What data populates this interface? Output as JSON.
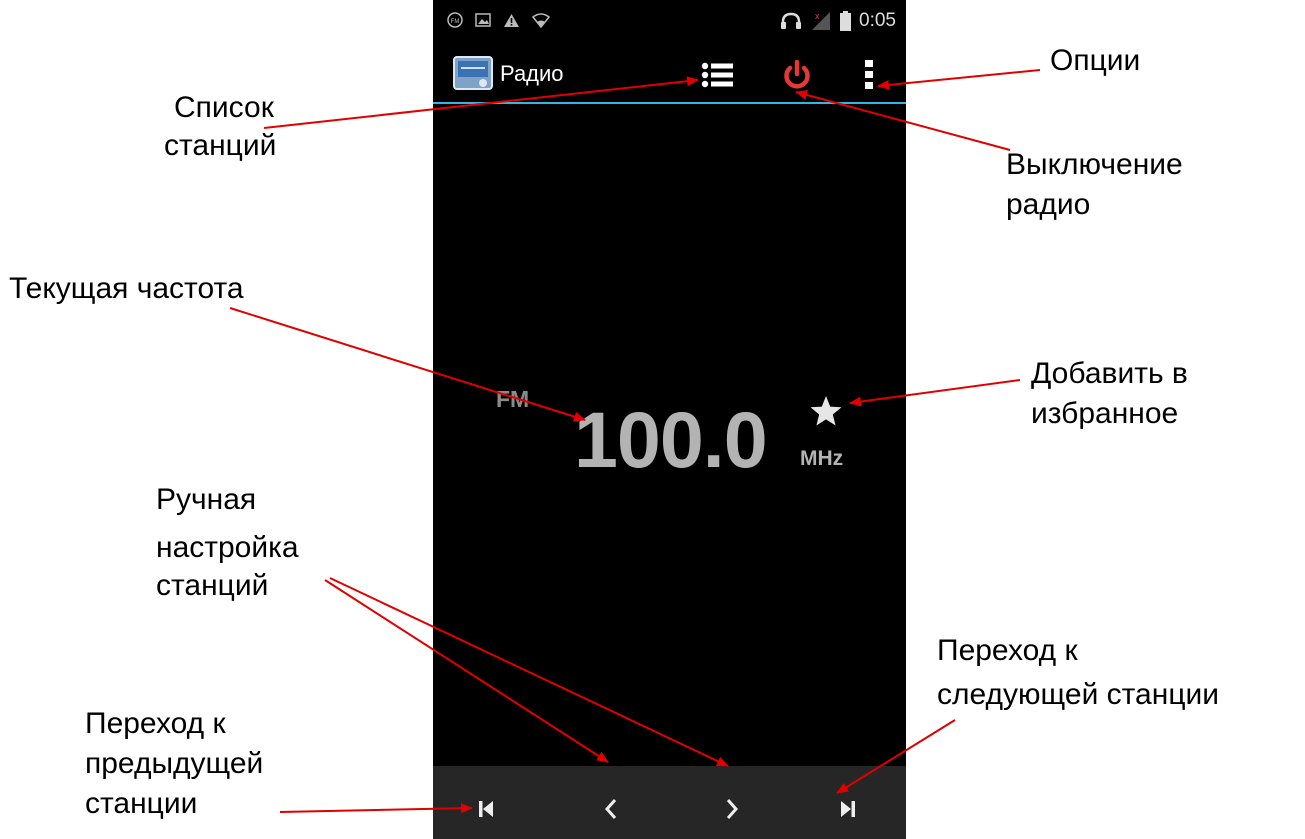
{
  "status_bar": {
    "time": "0:05",
    "left_icons": [
      "fm-notification-icon",
      "gallery-icon",
      "warning-icon",
      "wifi-icon"
    ],
    "right_icons": [
      "headphones-icon",
      "no-signal-icon",
      "battery-icon"
    ]
  },
  "action_bar": {
    "app_title": "Радио",
    "app_icon": "radio-app-icon",
    "buttons": [
      "station-list-icon",
      "power-icon",
      "overflow-menu-icon"
    ],
    "accent_color": "#33b5e5",
    "power_color": "#e53935"
  },
  "frequency": {
    "band": "FM",
    "value": "100.0",
    "unit": "MHz",
    "favorite_icon": "star-icon"
  },
  "bottom_bar": {
    "buttons": [
      "skip-previous-icon",
      "chevron-left-icon",
      "chevron-right-icon",
      "skip-next-icon"
    ]
  },
  "annotations": {
    "station_list": [
      "Список",
      "станций"
    ],
    "options": "Опции",
    "power_off": [
      "Выключение",
      "радио"
    ],
    "current_frequency": "Текущая частота",
    "add_favorite": [
      "Добавить в",
      "избранное"
    ],
    "manual_tuning": [
      "Ручная",
      "настройка",
      "станций"
    ],
    "next_station": [
      "Переход к",
      "следующей станции"
    ],
    "prev_station": [
      "Переход к",
      "предыдущей",
      "станции"
    ],
    "arrow_color": "#e00000"
  }
}
